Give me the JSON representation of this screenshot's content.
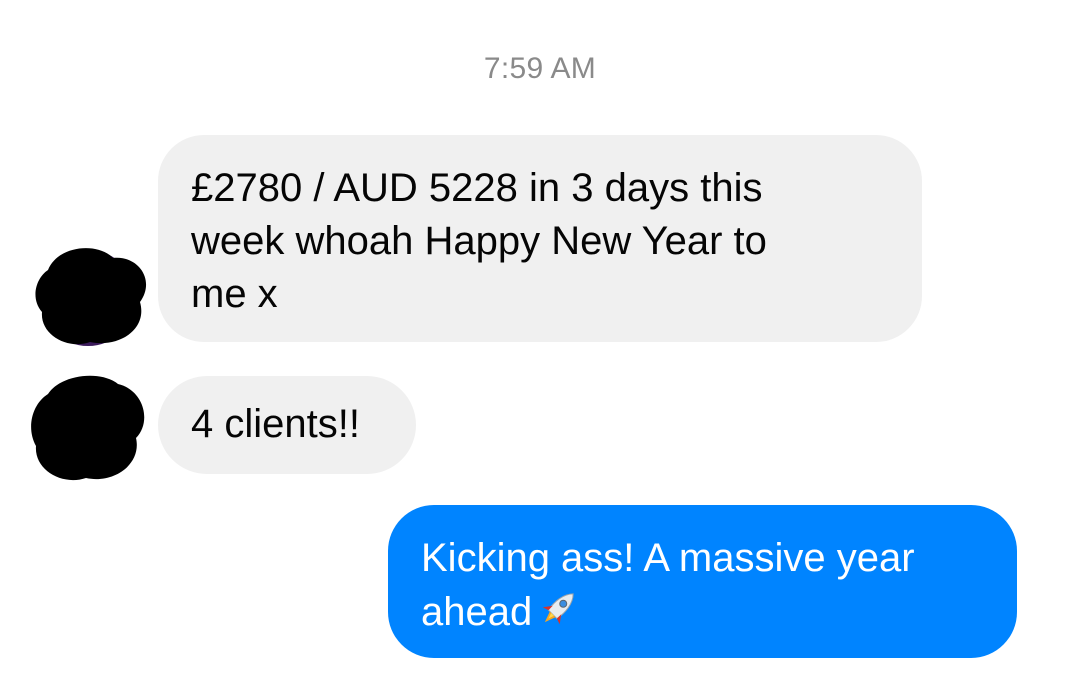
{
  "conversation": {
    "timestamp": "7:59 AM",
    "messages": [
      {
        "direction": "incoming",
        "text": "£2780 / AUD 5228 in 3 days this week whoah Happy New Year to me x",
        "lines": [
          "£2780 / AUD 5228 in 3 days this",
          "week whoah Happy New Year to",
          "me x"
        ]
      },
      {
        "direction": "incoming",
        "text": "4 clients!!"
      },
      {
        "direction": "outgoing",
        "lines": [
          "Kicking ass! A massive year",
          "ahead"
        ],
        "emoji_icon": "rocket-icon"
      }
    ]
  },
  "colors": {
    "incoming_bubble": "#f0f0f0",
    "outgoing_bubble": "#0084ff",
    "timestamp_text": "#8a8a8a",
    "redaction": "#000000"
  }
}
